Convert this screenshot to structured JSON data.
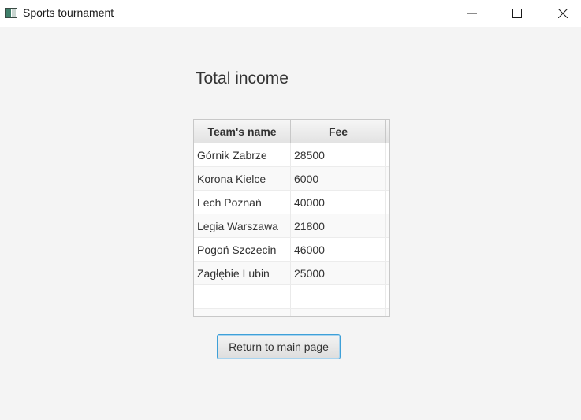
{
  "window": {
    "title": "Sports tournament"
  },
  "heading": "Total income",
  "table": {
    "columns": [
      "Team's name",
      "Fee"
    ],
    "rows": [
      {
        "name": "Górnik Zabrze",
        "fee": "28500"
      },
      {
        "name": "Korona Kielce",
        "fee": "6000"
      },
      {
        "name": "Lech Poznań",
        "fee": "40000"
      },
      {
        "name": "Legia Warszawa",
        "fee": "21800"
      },
      {
        "name": "Pogoń Szczecin",
        "fee": "46000"
      },
      {
        "name": "Zagłębie Lubin",
        "fee": "25000"
      }
    ]
  },
  "buttons": {
    "return_label": "Return to main page"
  },
  "colors": {
    "focus_accent": "#3ea0d8",
    "background": "#f4f4f4"
  },
  "icons": [
    "app-icon",
    "minimize-icon",
    "maximize-icon",
    "close-icon"
  ]
}
